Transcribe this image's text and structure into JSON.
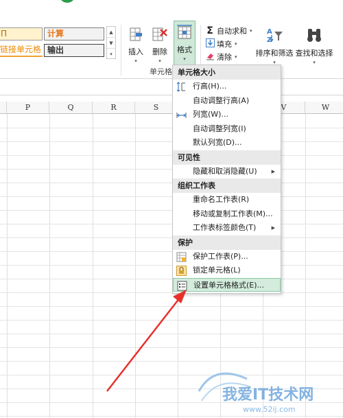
{
  "ribbon": {
    "styles": {
      "note_partial": "П",
      "calculation": "计算",
      "linked_cell_partial": "链接单元格",
      "output": "输出"
    },
    "cells_group": {
      "insert_label": "插入",
      "delete_label": "删除",
      "format_label": "格式",
      "group_label": "单元格"
    },
    "editing_group": {
      "autosum_label": "自动求和",
      "fill_label": "填充",
      "clear_label": "清除",
      "sort_filter_label": "排序和筛选",
      "find_select_label": "查找和选择"
    }
  },
  "grid": {
    "columns": [
      "P",
      "Q",
      "R",
      "S",
      "V",
      "W"
    ]
  },
  "menu": {
    "sections": [
      {
        "title": "单元格大小",
        "items": [
          {
            "label": "行高(H)...",
            "icon": "row-height-icon"
          },
          {
            "label": "自动调整行高(A)",
            "icon": ""
          },
          {
            "label": "列宽(W)...",
            "icon": "column-width-icon"
          },
          {
            "label": "自动调整列宽(I)",
            "icon": ""
          },
          {
            "label": "默认列宽(D)...",
            "icon": ""
          }
        ]
      },
      {
        "title": "可见性",
        "items": [
          {
            "label": "隐藏和取消隐藏(U)",
            "icon": "",
            "submenu": true
          }
        ]
      },
      {
        "title": "组织工作表",
        "items": [
          {
            "label": "重命名工作表(R)",
            "icon": ""
          },
          {
            "label": "移动或复制工作表(M)...",
            "icon": ""
          },
          {
            "label": "工作表标签颜色(T)",
            "icon": "",
            "submenu": true
          }
        ]
      },
      {
        "title": "保护",
        "items": [
          {
            "label": "保护工作表(P)...",
            "icon": "protect-sheet-icon"
          },
          {
            "label": "锁定单元格(L)",
            "icon": "lock-icon"
          },
          {
            "label": "设置单元格格式(E)...",
            "icon": "format-cells-icon",
            "highlighted": true
          }
        ]
      }
    ]
  },
  "watermark": {
    "title": "我爱IT技术网",
    "url": "www.52ij.com"
  },
  "colors": {
    "accent_green": "#217346",
    "highlight_bg": "#d3ecdc",
    "arrow_red": "#e8302a"
  }
}
